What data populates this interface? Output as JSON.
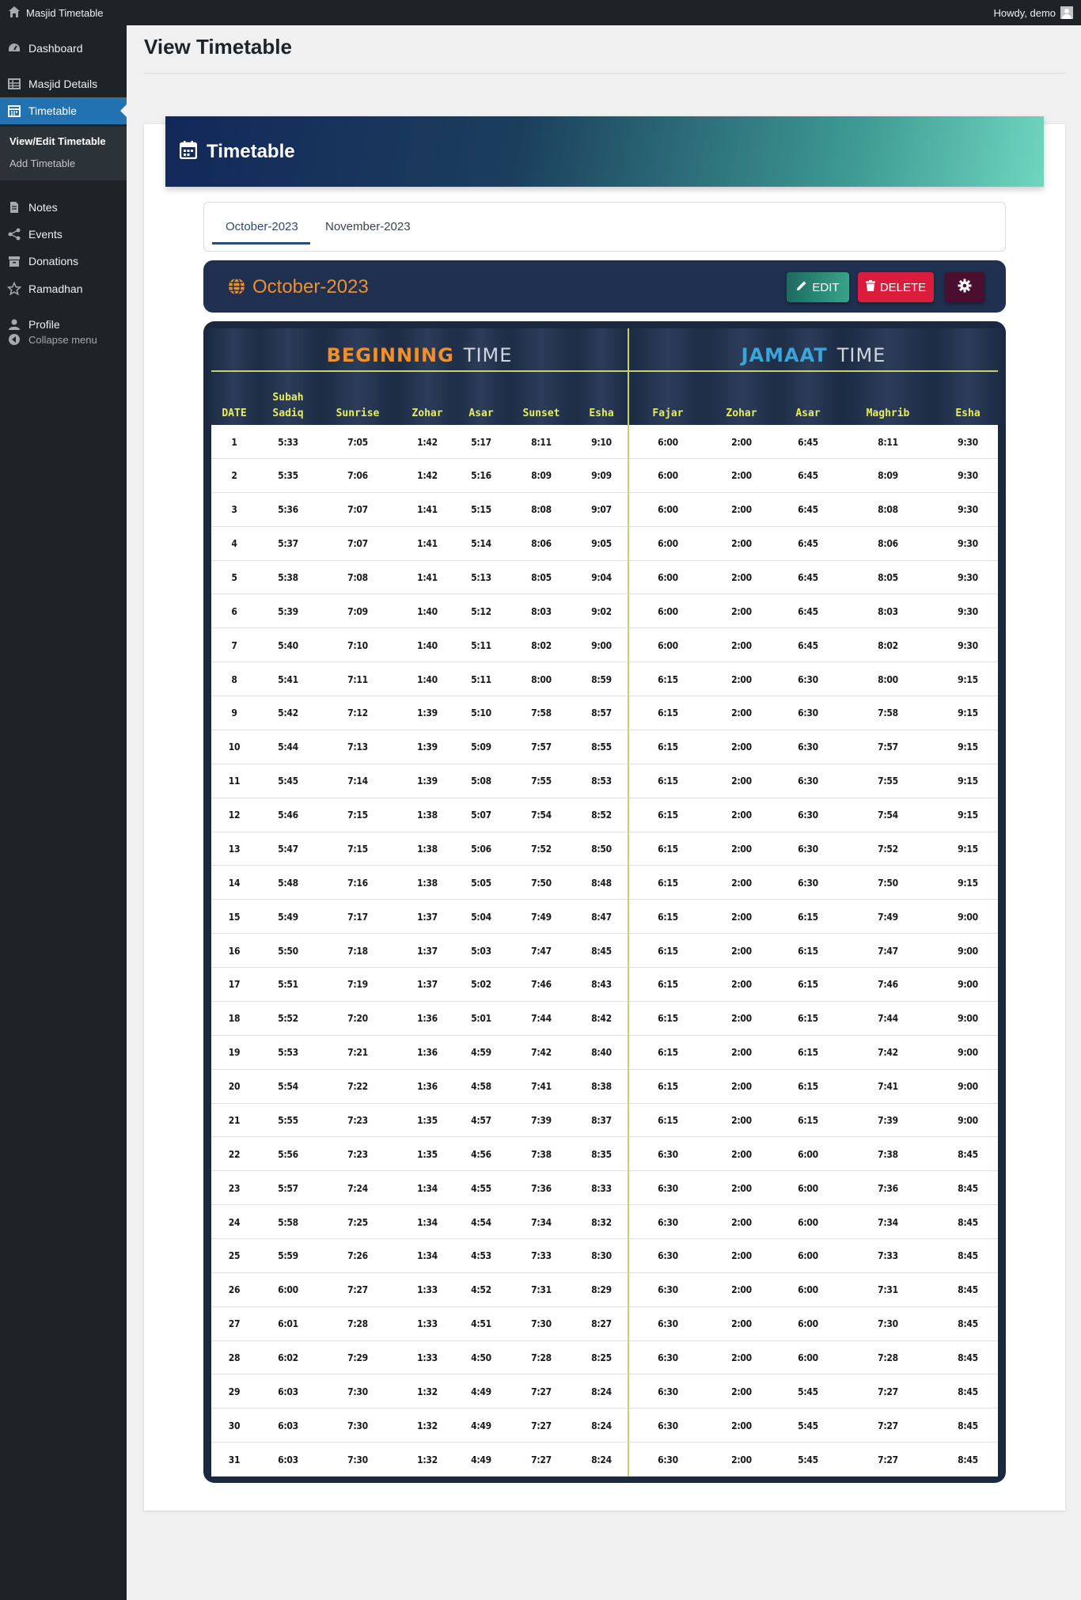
{
  "adminbar": {
    "site_name": "Masjid Timetable",
    "howdy": "Howdy, demo"
  },
  "sidebar": {
    "items": [
      {
        "label": "Dashboard",
        "icon": "dashboard-icon"
      },
      {
        "label": "Masjid Details",
        "icon": "table-icon"
      },
      {
        "label": "Timetable",
        "icon": "calendar-icon"
      },
      {
        "label": "Notes",
        "icon": "page-icon"
      },
      {
        "label": "Events",
        "icon": "share-icon"
      },
      {
        "label": "Donations",
        "icon": "archive-icon"
      },
      {
        "label": "Ramadhan",
        "icon": "star-icon"
      },
      {
        "label": "Profile",
        "icon": "user-icon"
      }
    ],
    "submenu": [
      "View/Edit Timetable",
      "Add Timetable"
    ],
    "collapse_label": "Collapse menu"
  },
  "page": {
    "title": "View Timetable"
  },
  "panel": {
    "title": "Timetable"
  },
  "tabs": [
    "October-2023",
    "November-2023"
  ],
  "month": {
    "title": "October-2023",
    "edit_label": "EDIT",
    "delete_label": "DELETE"
  },
  "timetable": {
    "beginning_title_1": "BEGINNING",
    "beginning_title_2": "TIME",
    "jamaat_title_1": "JAMAAT",
    "jamaat_title_2": "TIME",
    "columns": [
      "DATE",
      "Subah Sadiq",
      "Sunrise",
      "Zohar",
      "Asar",
      "Sunset",
      "Esha",
      "Fajar",
      "Zohar",
      "Asar",
      "Maghrib",
      "Esha"
    ],
    "rows": [
      [
        "1",
        "5:33",
        "7:05",
        "1:42",
        "5:17",
        "8:11",
        "9:10",
        "6:00",
        "2:00",
        "6:45",
        "8:11",
        "9:30"
      ],
      [
        "2",
        "5:35",
        "7:06",
        "1:42",
        "5:16",
        "8:09",
        "9:09",
        "6:00",
        "2:00",
        "6:45",
        "8:09",
        "9:30"
      ],
      [
        "3",
        "5:36",
        "7:07",
        "1:41",
        "5:15",
        "8:08",
        "9:07",
        "6:00",
        "2:00",
        "6:45",
        "8:08",
        "9:30"
      ],
      [
        "4",
        "5:37",
        "7:07",
        "1:41",
        "5:14",
        "8:06",
        "9:05",
        "6:00",
        "2:00",
        "6:45",
        "8:06",
        "9:30"
      ],
      [
        "5",
        "5:38",
        "7:08",
        "1:41",
        "5:13",
        "8:05",
        "9:04",
        "6:00",
        "2:00",
        "6:45",
        "8:05",
        "9:30"
      ],
      [
        "6",
        "5:39",
        "7:09",
        "1:40",
        "5:12",
        "8:03",
        "9:02",
        "6:00",
        "2:00",
        "6:45",
        "8:03",
        "9:30"
      ],
      [
        "7",
        "5:40",
        "7:10",
        "1:40",
        "5:11",
        "8:02",
        "9:00",
        "6:00",
        "2:00",
        "6:45",
        "8:02",
        "9:30"
      ],
      [
        "8",
        "5:41",
        "7:11",
        "1:40",
        "5:11",
        "8:00",
        "8:59",
        "6:15",
        "2:00",
        "6:30",
        "8:00",
        "9:15"
      ],
      [
        "9",
        "5:42",
        "7:12",
        "1:39",
        "5:10",
        "7:58",
        "8:57",
        "6:15",
        "2:00",
        "6:30",
        "7:58",
        "9:15"
      ],
      [
        "10",
        "5:44",
        "7:13",
        "1:39",
        "5:09",
        "7:57",
        "8:55",
        "6:15",
        "2:00",
        "6:30",
        "7:57",
        "9:15"
      ],
      [
        "11",
        "5:45",
        "7:14",
        "1:39",
        "5:08",
        "7:55",
        "8:53",
        "6:15",
        "2:00",
        "6:30",
        "7:55",
        "9:15"
      ],
      [
        "12",
        "5:46",
        "7:15",
        "1:38",
        "5:07",
        "7:54",
        "8:52",
        "6:15",
        "2:00",
        "6:30",
        "7:54",
        "9:15"
      ],
      [
        "13",
        "5:47",
        "7:15",
        "1:38",
        "5:06",
        "7:52",
        "8:50",
        "6:15",
        "2:00",
        "6:30",
        "7:52",
        "9:15"
      ],
      [
        "14",
        "5:48",
        "7:16",
        "1:38",
        "5:05",
        "7:50",
        "8:48",
        "6:15",
        "2:00",
        "6:30",
        "7:50",
        "9:15"
      ],
      [
        "15",
        "5:49",
        "7:17",
        "1:37",
        "5:04",
        "7:49",
        "8:47",
        "6:15",
        "2:00",
        "6:15",
        "7:49",
        "9:00"
      ],
      [
        "16",
        "5:50",
        "7:18",
        "1:37",
        "5:03",
        "7:47",
        "8:45",
        "6:15",
        "2:00",
        "6:15",
        "7:47",
        "9:00"
      ],
      [
        "17",
        "5:51",
        "7:19",
        "1:37",
        "5:02",
        "7:46",
        "8:43",
        "6:15",
        "2:00",
        "6:15",
        "7:46",
        "9:00"
      ],
      [
        "18",
        "5:52",
        "7:20",
        "1:36",
        "5:01",
        "7:44",
        "8:42",
        "6:15",
        "2:00",
        "6:15",
        "7:44",
        "9:00"
      ],
      [
        "19",
        "5:53",
        "7:21",
        "1:36",
        "4:59",
        "7:42",
        "8:40",
        "6:15",
        "2:00",
        "6:15",
        "7:42",
        "9:00"
      ],
      [
        "20",
        "5:54",
        "7:22",
        "1:36",
        "4:58",
        "7:41",
        "8:38",
        "6:15",
        "2:00",
        "6:15",
        "7:41",
        "9:00"
      ],
      [
        "21",
        "5:55",
        "7:23",
        "1:35",
        "4:57",
        "7:39",
        "8:37",
        "6:15",
        "2:00",
        "6:15",
        "7:39",
        "9:00"
      ],
      [
        "22",
        "5:56",
        "7:23",
        "1:35",
        "4:56",
        "7:38",
        "8:35",
        "6:30",
        "2:00",
        "6:00",
        "7:38",
        "8:45"
      ],
      [
        "23",
        "5:57",
        "7:24",
        "1:34",
        "4:55",
        "7:36",
        "8:33",
        "6:30",
        "2:00",
        "6:00",
        "7:36",
        "8:45"
      ],
      [
        "24",
        "5:58",
        "7:25",
        "1:34",
        "4:54",
        "7:34",
        "8:32",
        "6:30",
        "2:00",
        "6:00",
        "7:34",
        "8:45"
      ],
      [
        "25",
        "5:59",
        "7:26",
        "1:34",
        "4:53",
        "7:33",
        "8:30",
        "6:30",
        "2:00",
        "6:00",
        "7:33",
        "8:45"
      ],
      [
        "26",
        "6:00",
        "7:27",
        "1:33",
        "4:52",
        "7:31",
        "8:29",
        "6:30",
        "2:00",
        "6:00",
        "7:31",
        "8:45"
      ],
      [
        "27",
        "6:01",
        "7:28",
        "1:33",
        "4:51",
        "7:30",
        "8:27",
        "6:30",
        "2:00",
        "6:00",
        "7:30",
        "8:45"
      ],
      [
        "28",
        "6:02",
        "7:29",
        "1:33",
        "4:50",
        "7:28",
        "8:25",
        "6:30",
        "2:00",
        "6:00",
        "7:28",
        "8:45"
      ],
      [
        "29",
        "6:03",
        "7:30",
        "1:32",
        "4:49",
        "7:27",
        "8:24",
        "6:30",
        "2:00",
        "5:45",
        "7:27",
        "8:45"
      ],
      [
        "30",
        "6:03",
        "7:30",
        "1:32",
        "4:49",
        "7:27",
        "8:24",
        "6:30",
        "2:00",
        "5:45",
        "7:27",
        "8:45"
      ],
      [
        "31",
        "6:03",
        "7:30",
        "1:32",
        "4:49",
        "7:27",
        "8:24",
        "6:30",
        "2:00",
        "5:45",
        "7:27",
        "8:45"
      ]
    ]
  },
  "colors": {
    "sidebar_bg": "#1d2327",
    "active_blue": "#2271b1",
    "orange_accent": "#f0902a",
    "header_yellow": "#e6ee5a",
    "jamaat_blue": "#3aa5d8",
    "delete_red": "#dc1c3c",
    "edit_green": "#2f8f7a"
  }
}
